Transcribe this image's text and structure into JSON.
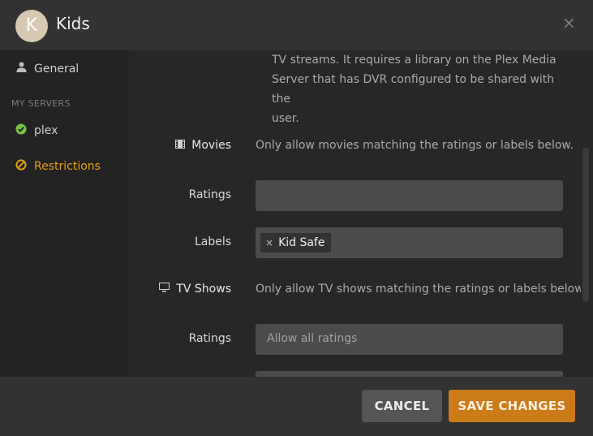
{
  "header": {
    "avatar_letter": "K",
    "title": "Kids",
    "close_icon": "×"
  },
  "sidebar": {
    "general_label": "General",
    "section_label": "MY SERVERS",
    "server_label": "plex",
    "restrictions_label": "Restrictions"
  },
  "main": {
    "desc_lines": [
      "TV streams. It requires a library on the Plex Media",
      "Server that has DVR configured to be shared with the",
      "user."
    ],
    "movies": {
      "label": "Movies",
      "help": "Only allow movies matching the ratings or labels below.",
      "ratings_label": "Ratings",
      "ratings_value": "",
      "labels_label": "Labels",
      "tag_label": "Kid Safe",
      "tag_remove": "×"
    },
    "tv": {
      "label": "TV Shows",
      "help": "Only allow TV shows matching the ratings or labels below.",
      "ratings_label": "Ratings",
      "ratings_placeholder": "Allow all ratings"
    }
  },
  "footer": {
    "cancel_label": "CANCEL",
    "save_label": "SAVE CHANGES"
  },
  "colors": {
    "accent": "#e5a00d",
    "save_button": "#cc7b19",
    "success": "#7ac142"
  }
}
